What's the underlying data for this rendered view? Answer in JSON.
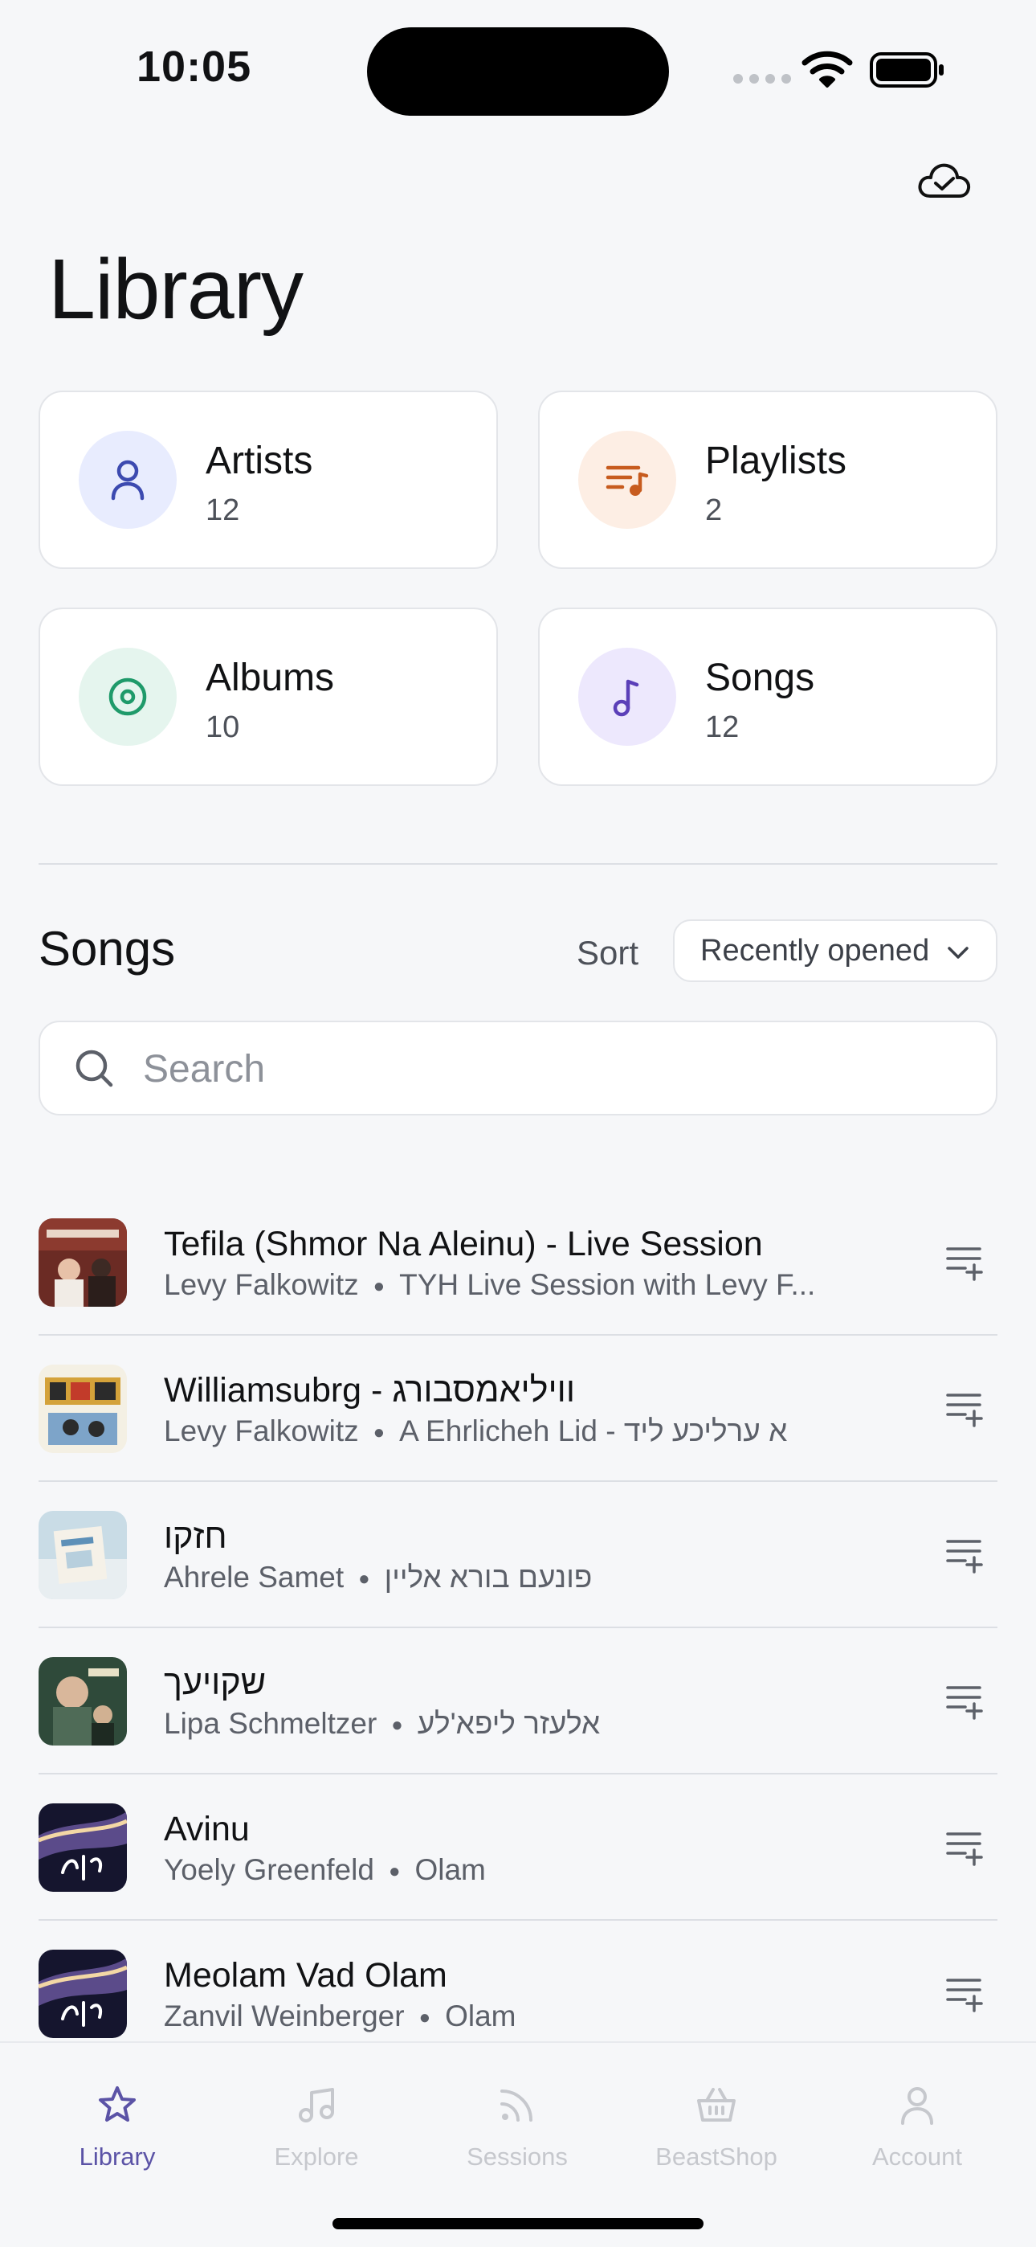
{
  "status_bar": {
    "time": "10:05"
  },
  "header": {
    "title": "Library"
  },
  "categories": [
    {
      "label": "Artists",
      "count": "12",
      "icon": "person-icon",
      "color": "#3c4ab0",
      "bg": "#e8ecfe"
    },
    {
      "label": "Playlists",
      "count": "2",
      "icon": "playlist-icon",
      "color": "#c75b1e",
      "bg": "#fdeee4"
    },
    {
      "label": "Albums",
      "count": "10",
      "icon": "album-icon",
      "color": "#1f9a6a",
      "bg": "#e5f5ee"
    },
    {
      "label": "Songs",
      "count": "12",
      "icon": "music-note-icon",
      "color": "#5b3fb8",
      "bg": "#ede8fd"
    }
  ],
  "songs_section": {
    "title": "Songs",
    "sort_label": "Sort",
    "sort_value": "Recently opened",
    "search_placeholder": "Search"
  },
  "songs": [
    {
      "title": "Tefila (Shmor Na Aleinu) - Live Session",
      "artist": "Levy Falkowitz",
      "album": "TYH Live Session with Levy F..."
    },
    {
      "title": "Williamsubrg - וויליאמסבורג",
      "artist": "Levy Falkowitz",
      "album": "A Ehrlicheh Lid - א ערליכע ליד"
    },
    {
      "title": "חזקו",
      "artist": "Ahrele Samet",
      "album": "פונעם בורא אליין"
    },
    {
      "title": "שקויעך",
      "artist": "Lipa Schmeltzer",
      "album": "אלעזר ליפא'לע"
    },
    {
      "title": "Avinu",
      "artist": "Yoely Greenfeld",
      "album": "Olam"
    },
    {
      "title": "Meolam Vad Olam",
      "artist": "Zanvil Weinberger",
      "album": "Olam"
    }
  ],
  "tabs": [
    {
      "label": "Library",
      "icon": "star-icon",
      "active": true
    },
    {
      "label": "Explore",
      "icon": "music-note-icon",
      "active": false
    },
    {
      "label": "Sessions",
      "icon": "broadcast-icon",
      "active": false
    },
    {
      "label": "BeastShop",
      "icon": "basket-icon",
      "active": false
    },
    {
      "label": "Account",
      "icon": "person-icon",
      "active": false
    }
  ],
  "colors": {
    "accent": "#5b53a6",
    "inactive_tab": "#c6c8cd"
  }
}
